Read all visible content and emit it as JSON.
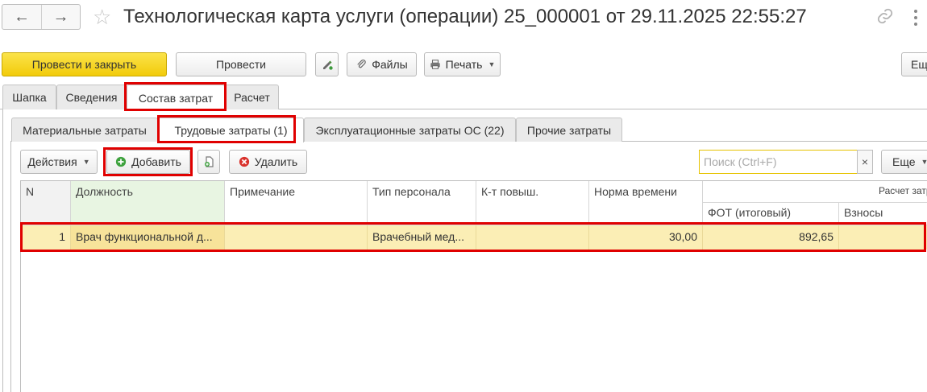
{
  "window": {
    "title": "Технологическая карта услуги (операции) 25_000001 от 29.11.2025 22:55:27",
    "back_icon": "arrow-left-icon",
    "forward_icon": "arrow-right-icon",
    "favorite_icon": "star-icon",
    "link_icon": "link-icon",
    "menu_icon": "more-vertical-icon"
  },
  "toolbar": {
    "post_and_close": "Провести и закрыть",
    "post": "Провести",
    "files": "Файлы",
    "print": "Печать",
    "more": "Ещ"
  },
  "main_tabs": [
    {
      "label": "Шапка"
    },
    {
      "label": "Сведения"
    },
    {
      "label": "Состав затрат",
      "active": true
    },
    {
      "label": "Расчет"
    }
  ],
  "sub_tabs": [
    {
      "label": "Материальные затраты"
    },
    {
      "label": "Трудовые затраты (1)",
      "active": true
    },
    {
      "label": "Эксплуатационные затраты ОС (22)"
    },
    {
      "label": "Прочие затраты"
    }
  ],
  "table_toolbar": {
    "actions": "Действия",
    "add": "Добавить",
    "delete": "Удалить",
    "search_placeholder": "Поиск (Ctrl+F)",
    "clear": "×",
    "more": "Еще"
  },
  "table": {
    "columns": [
      "N",
      "Должность",
      "Примечание",
      "Тип персонала",
      "К-т повыш.",
      "Норма времени"
    ],
    "group_header": "Расчет затр",
    "sub_columns": [
      "ФОТ (итоговый)",
      "Взносы"
    ],
    "rows": [
      {
        "n": "1",
        "position": "Врач функциональной д...",
        "note": "",
        "staff_type": "Врачебный мед...",
        "coef": "",
        "time_norm": "30,00",
        "fot": "892,65",
        "contrib": ""
      }
    ]
  },
  "colors": {
    "primary_button": "#f5d21a",
    "highlight_frame": "#e00000",
    "selected_row": "#fbeeb5",
    "header_green": "#e8f5e2",
    "search_border": "#e6c300"
  }
}
